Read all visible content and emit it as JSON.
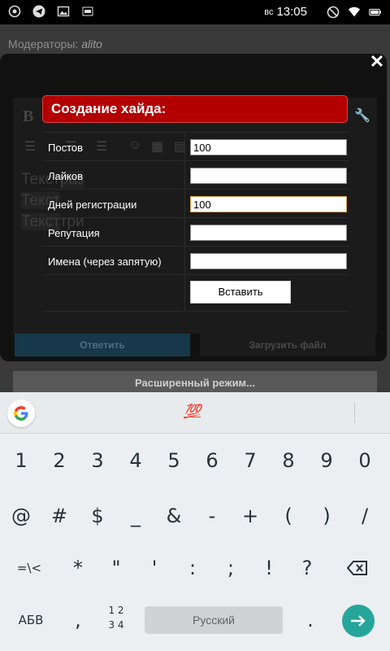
{
  "status_bar": {
    "icons_left": [
      "eye-icon",
      "telegram-icon",
      "image-icon",
      "sim-icon"
    ],
    "day": "вс",
    "time": "13:05",
    "icons_right": [
      "dnd-icon",
      "wifi-icon",
      "battery-icon"
    ]
  },
  "page": {
    "moderators_label": "Модераторы:",
    "moderators_name": "alito",
    "editor_text": [
      "Текст",
      "раз",
      "Текст",
      "Текст",
      "три"
    ],
    "reply_button": "Ответить",
    "upload_button": "Загрузить файл",
    "advanced_button": "Расширенный режим..."
  },
  "modal": {
    "title": "Создание хайда:",
    "fields": [
      {
        "label": "Постов",
        "value": "100"
      },
      {
        "label": "Лайков",
        "value": ""
      },
      {
        "label": "Дней регистрации",
        "value": "100"
      },
      {
        "label": "Репутация",
        "value": ""
      },
      {
        "label": "Имена (через запятую)",
        "value": ""
      }
    ],
    "insert_button": "Вставить"
  },
  "keyboard": {
    "suggestion": "💯",
    "row1": [
      "1",
      "2",
      "3",
      "4",
      "5",
      "6",
      "7",
      "8",
      "9",
      "0"
    ],
    "row2": [
      "@",
      "#",
      "$",
      "_",
      "&",
      "-",
      "+",
      "(",
      ")",
      "/"
    ],
    "row3": [
      "=\\<",
      "*",
      "\"",
      "'",
      ":",
      ";",
      "!",
      "?"
    ],
    "abc_key": "АБВ",
    "comma_key": ",",
    "numpad_key_top": "1 2",
    "numpad_key_bottom": "3 4",
    "space_label": "Русский",
    "period_key": "."
  }
}
